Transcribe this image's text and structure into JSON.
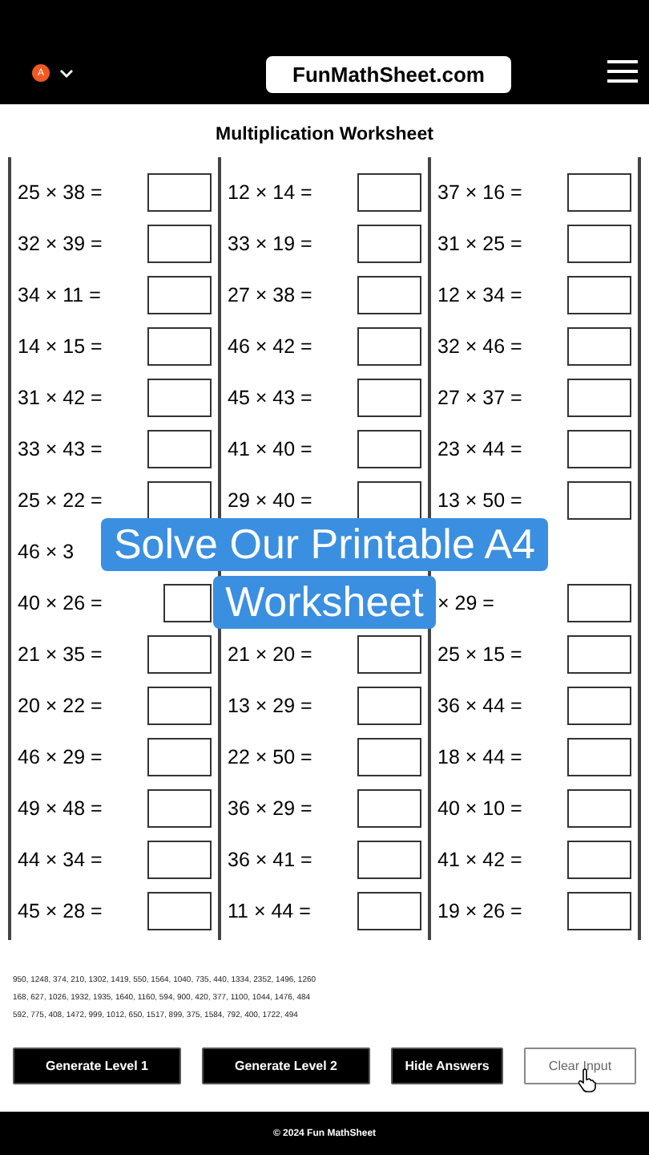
{
  "header": {
    "avatar": "A",
    "logo": "FunMathSheet.com"
  },
  "title": "Multiplication Worksheet",
  "columns": [
    {
      "problems": [
        {
          "text": "25 × 38 ="
        },
        {
          "text": "32 × 39 ="
        },
        {
          "text": "34 × 11 ="
        },
        {
          "text": "14 × 15 ="
        },
        {
          "text": "31 × 42 ="
        },
        {
          "text": "33 × 43 ="
        },
        {
          "text": "25 × 22 ="
        },
        {
          "text": "46 × 3"
        },
        {
          "text": "40 × 26 ="
        },
        {
          "text": "21 × 35 ="
        },
        {
          "text": "20 × 22 ="
        },
        {
          "text": "46 × 29 ="
        },
        {
          "text": "49 × 48 ="
        },
        {
          "text": "44 × 34 ="
        },
        {
          "text": "45 × 28 ="
        }
      ]
    },
    {
      "problems": [
        {
          "text": "12 × 14 ="
        },
        {
          "text": "33 × 19 ="
        },
        {
          "text": "27 × 38 ="
        },
        {
          "text": "46 × 42 ="
        },
        {
          "text": "45 × 43 ="
        },
        {
          "text": "41 × 40 ="
        },
        {
          "text": "29 × 40 ="
        },
        {
          "kind": "covered"
        },
        {
          "kind": "covered"
        },
        {
          "text": "21 × 20 ="
        },
        {
          "text": "13 × 29 ="
        },
        {
          "text": "22 × 50 ="
        },
        {
          "text": "36 × 29 ="
        },
        {
          "text": "36 × 41 ="
        },
        {
          "text": "11 × 44 ="
        }
      ]
    },
    {
      "problems": [
        {
          "text": "37 × 16 ="
        },
        {
          "text": "31 × 25 ="
        },
        {
          "text": "12 × 34 ="
        },
        {
          "text": "32 × 46 ="
        },
        {
          "text": "27 × 37 ="
        },
        {
          "text": "23 × 44 ="
        },
        {
          "text": "13 × 50 ="
        },
        {
          "kind": "covered"
        },
        {
          "text": "× 29 ="
        },
        {
          "text": "25 × 15 ="
        },
        {
          "text": "36 × 44 ="
        },
        {
          "text": "18 × 44 ="
        },
        {
          "text": "40 × 10 ="
        },
        {
          "text": "41 × 42 ="
        },
        {
          "text": "19 × 26 ="
        }
      ]
    }
  ],
  "answers": [
    "950, 1248, 374, 210, 1302, 1419, 550, 1564, 1040, 735, 440, 1334, 2352, 1496, 1260",
    "168, 627, 1026, 1932, 1935, 1640, 1160, 594, 900, 420, 377, 1100, 1044, 1476, 484",
    "592, 775, 408, 1472, 999, 1012, 650, 1517, 899, 375, 1584, 792, 400, 1722, 494"
  ],
  "buttons": [
    {
      "label": "Generate Level 1",
      "kind": "filled"
    },
    {
      "label": "Generate Level 2",
      "kind": "filled"
    },
    {
      "label": "Hide Answers",
      "kind": "filled"
    },
    {
      "label": "Clear Input",
      "kind": "outline"
    }
  ],
  "banner": [
    "Solve Our Printable A4",
    "Worksheet"
  ],
  "footer": "© 2024 Fun MathSheet"
}
